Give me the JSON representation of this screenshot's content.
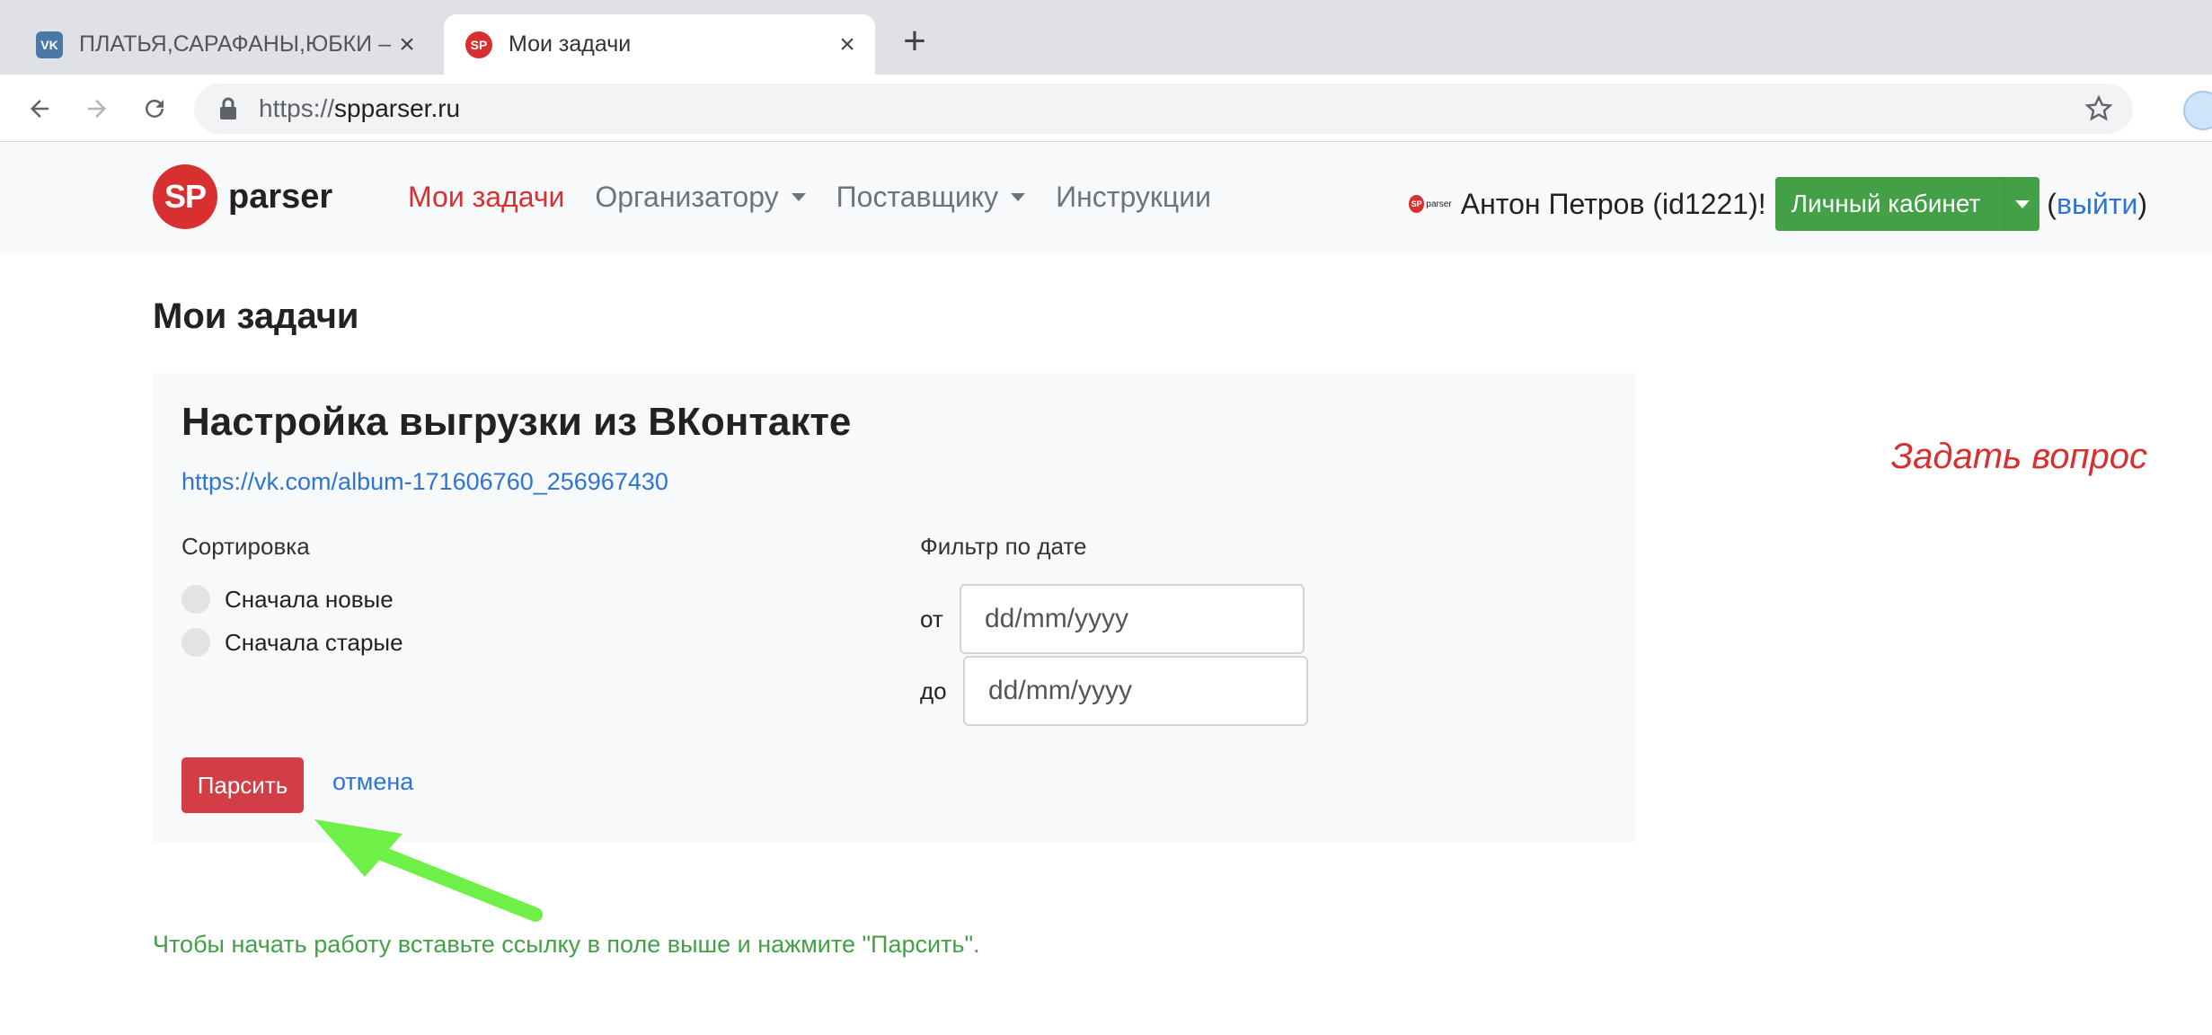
{
  "browser": {
    "tabs": [
      {
        "favicon": "VK",
        "title": "ПЛАТЬЯ,САРАФАНЫ,ЮБКИ – ..."
      },
      {
        "favicon": "SP",
        "title": "Мои задачи"
      }
    ],
    "url_scheme": "https://",
    "url_host": "spparser.ru"
  },
  "header": {
    "logo_mark": "SP",
    "logo_text": "parser",
    "nav": [
      {
        "label": "Мои задачи"
      },
      {
        "label": "Организатору"
      },
      {
        "label": "Поставщику"
      },
      {
        "label": "Инструкции"
      }
    ],
    "user_greeting": "Антон Петров (id1221)!",
    "mini_logo_mark": "SP",
    "mini_logo_text": "parser",
    "cabinet_label": "Личный кабинет",
    "logout_open": "(",
    "logout_label": "выйти",
    "logout_close": ")"
  },
  "main": {
    "page_title": "Мои задачи",
    "panel_title": "Настройка выгрузки из ВКонтакте",
    "album_link": "https://vk.com/album-171606760_256967430",
    "sort_label": "Сортировка",
    "sort_options": [
      "Сначала новые",
      "Сначала старые"
    ],
    "date_filter_label": "Фильтр по дате",
    "from_label": "от",
    "to_label": "до",
    "date_placeholder": "dd/mm/yyyy",
    "parse_button": "Парсить",
    "cancel_link": "отмена",
    "ask_question": "Задать вопрос",
    "hint": "Чтобы начать работу вставьте ссылку в поле выше и нажмите \"Парсить\"."
  },
  "colors": {
    "brand_red": "#d83030",
    "link_blue": "#2d74d6",
    "green": "#43a047",
    "arrow_green": "#6ef048"
  }
}
